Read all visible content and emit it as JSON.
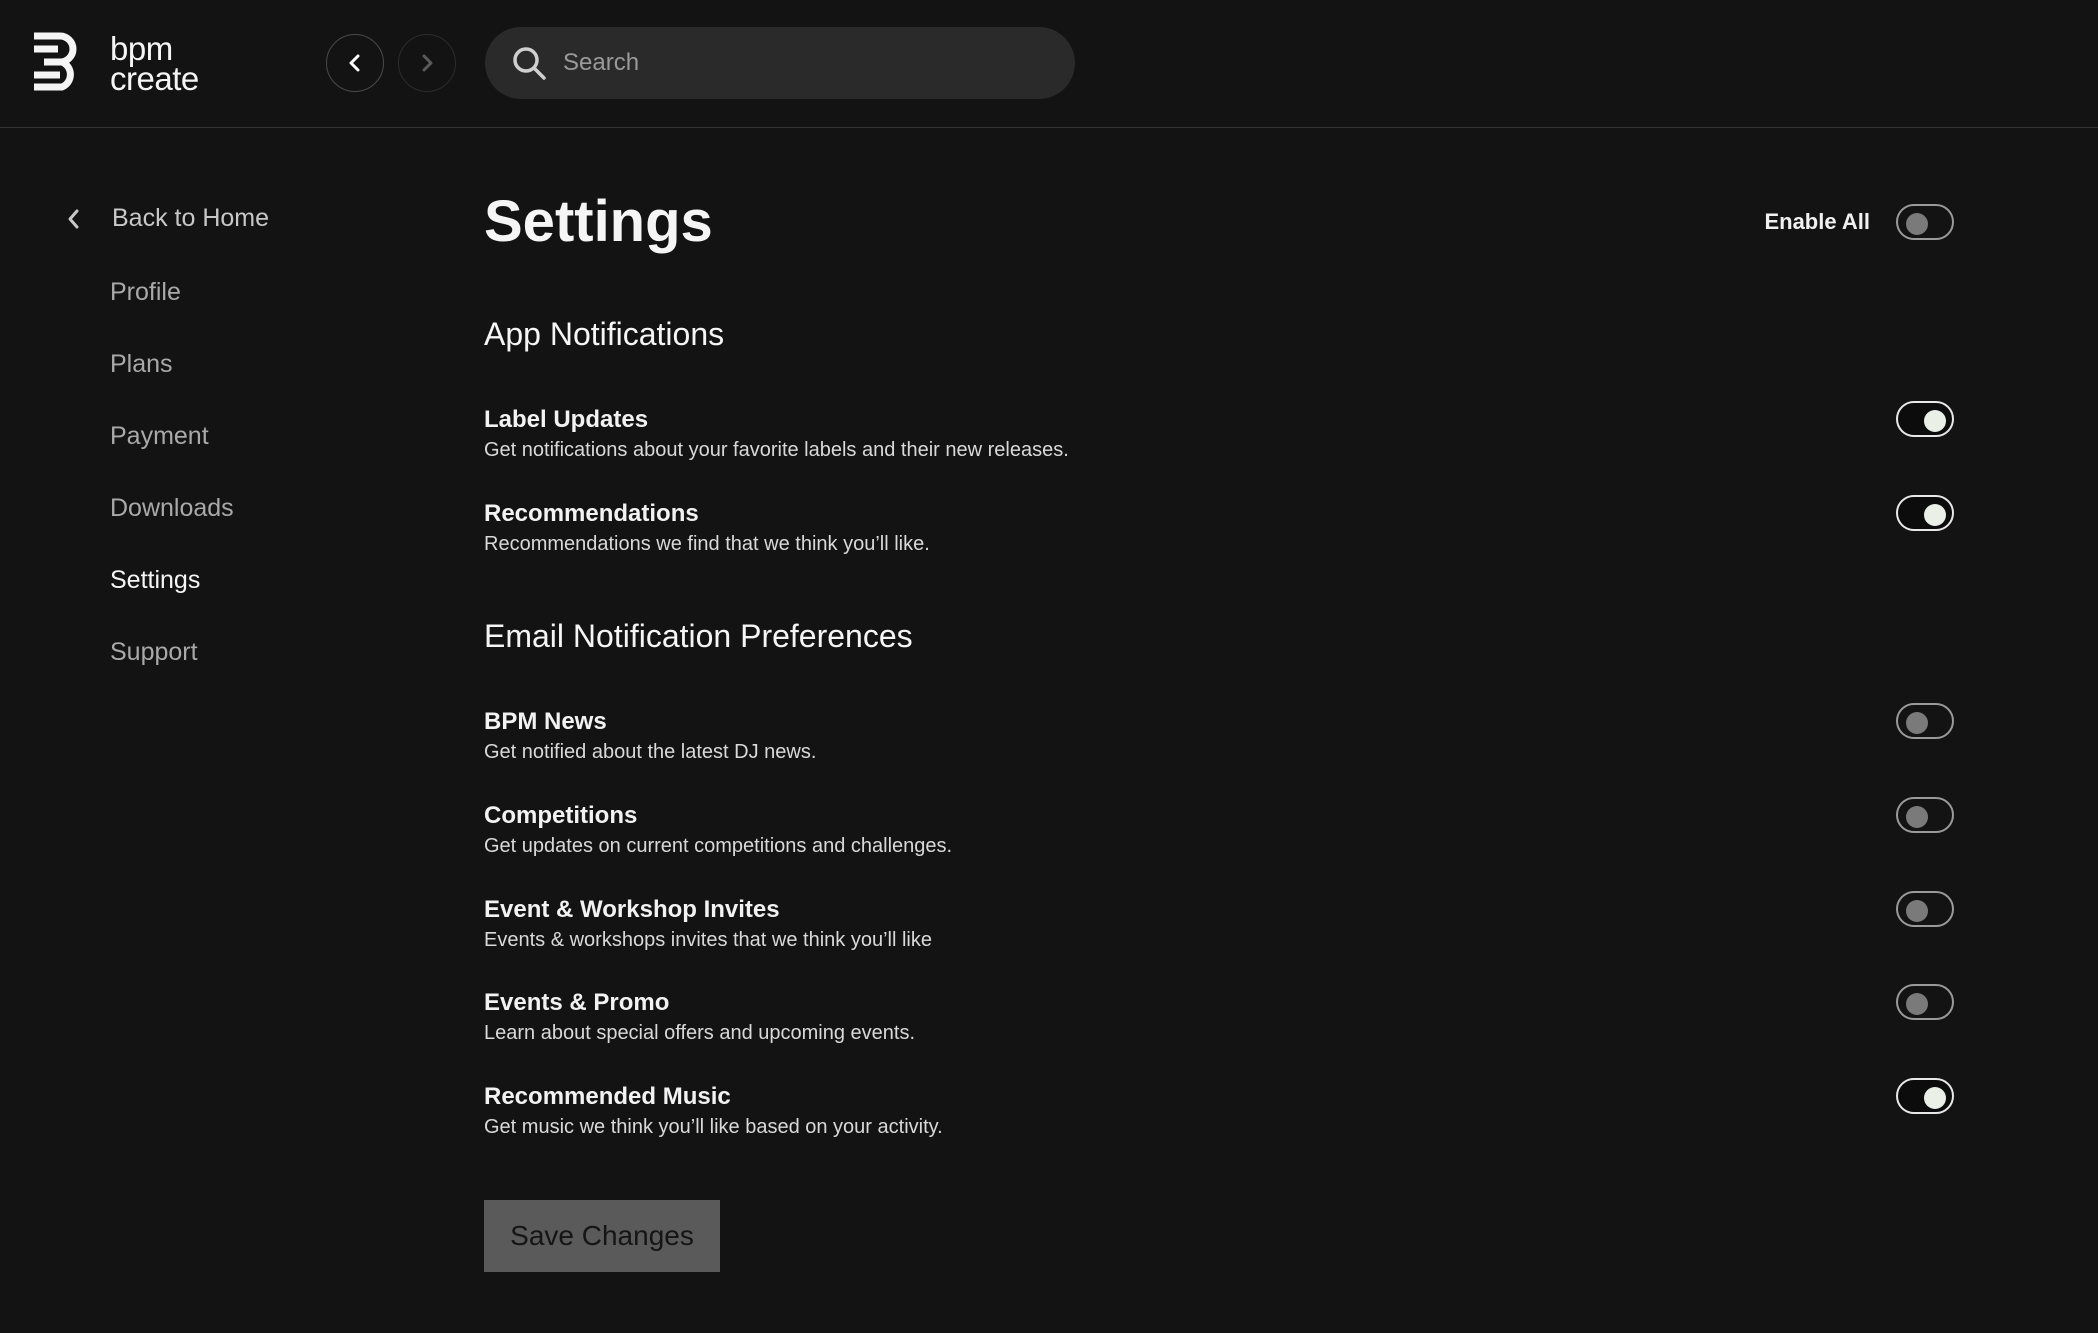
{
  "header": {
    "brand_line1": "bpm",
    "brand_line2": "create",
    "search_placeholder": "Search"
  },
  "sidebar": {
    "back_label": "Back to Home",
    "items": [
      {
        "label": "Profile",
        "active": false
      },
      {
        "label": "Plans",
        "active": false
      },
      {
        "label": "Payment",
        "active": false
      },
      {
        "label": "Downloads",
        "active": false
      },
      {
        "label": "Settings",
        "active": true
      },
      {
        "label": "Support",
        "active": false
      }
    ]
  },
  "main": {
    "title": "Settings",
    "enable_all_label": "Enable All",
    "enable_all_on": false,
    "app_section": {
      "title": "App Notifications",
      "items": [
        {
          "title": "Label Updates",
          "desc": "Get notifications about your favorite labels and their new releases.",
          "on": true
        },
        {
          "title": "Recommendations",
          "desc": "Recommendations we find that we think you’ll like.",
          "on": true
        }
      ]
    },
    "email_section": {
      "title": "Email Notification Preferences",
      "items": [
        {
          "title": "BPM News",
          "desc": "Get notified about the latest DJ news.",
          "on": false
        },
        {
          "title": "Competitions",
          "desc": "Get updates on current competitions and challenges.",
          "on": false
        },
        {
          "title": "Event & Workshop Invites",
          "desc": "Events & workshops invites that we think you’ll like",
          "on": false
        },
        {
          "title": "Events & Promo",
          "desc": "Learn about special offers and upcoming events.",
          "on": false
        },
        {
          "title": "Recommended Music",
          "desc": "Get music we think you’ll like based on your activity.",
          "on": true
        }
      ]
    },
    "save_label": "Save Changes"
  },
  "colors": {
    "background": "#131313",
    "search_bg": "#2a2a2a",
    "toggle_on_knob": "#eaf0e8",
    "toggle_off_knob": "#7a7a7a",
    "save_button_bg": "#5a5a5a"
  }
}
